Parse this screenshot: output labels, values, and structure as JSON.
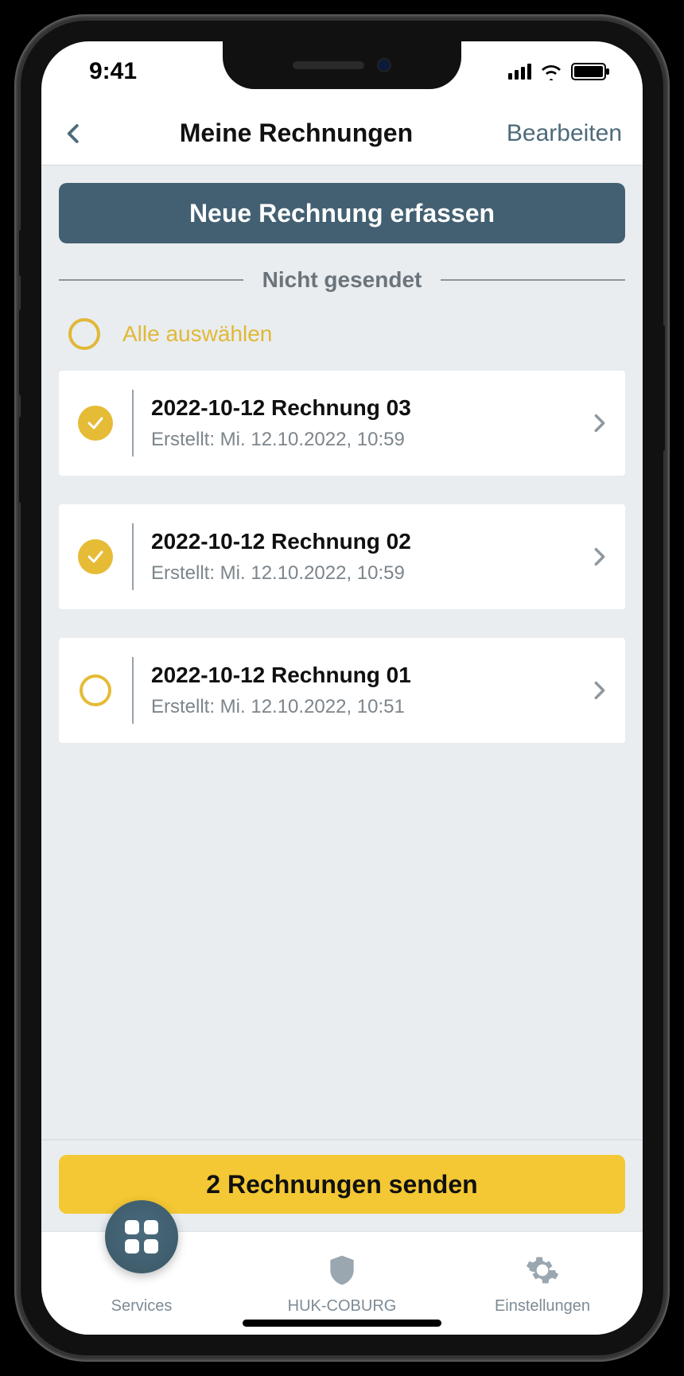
{
  "status": {
    "time": "9:41"
  },
  "nav": {
    "title": "Meine Rechnungen",
    "edit_label": "Bearbeiten"
  },
  "actions": {
    "new_invoice_label": "Neue Rechnung erfassen",
    "section_unsent_label": "Nicht gesendet",
    "select_all_label": "Alle auswählen",
    "send_label": "2 Rechnungen senden"
  },
  "invoices": [
    {
      "title": "2022-10-12 Rechnung 03",
      "subtitle": "Erstellt: Mi. 12.10.2022, 10:59",
      "selected": true
    },
    {
      "title": "2022-10-12 Rechnung 02",
      "subtitle": "Erstellt: Mi. 12.10.2022, 10:59",
      "selected": true
    },
    {
      "title": "2022-10-12 Rechnung 01",
      "subtitle": "Erstellt: Mi. 12.10.2022, 10:51",
      "selected": false
    }
  ],
  "tabs": {
    "services": "Services",
    "huk": "HUK-COBURG",
    "settings": "Einstellungen"
  },
  "colors": {
    "accent_teal": "#436072",
    "accent_yellow": "#e6bb36",
    "button_yellow": "#f3c834",
    "bg_grey": "#e9edf0",
    "text_muted": "#7c858b"
  }
}
